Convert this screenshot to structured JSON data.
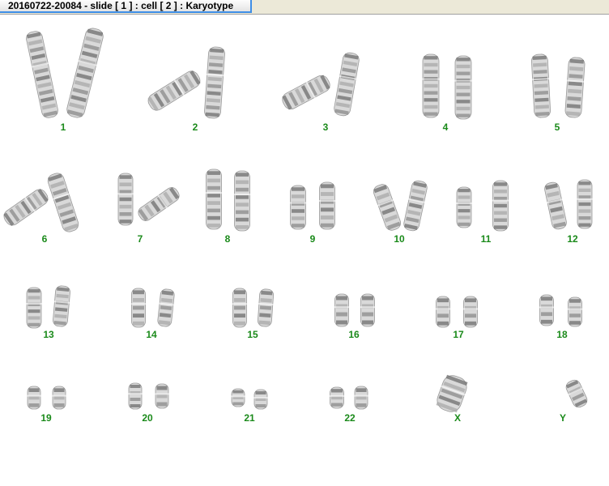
{
  "window": {
    "title": "20160722-20084 - slide [ 1 ] : cell [ 2 ] : Karyotype"
  },
  "karyotype": {
    "label_color": "#1a8a1a",
    "chromosomes": [
      {
        "label": "1"
      },
      {
        "label": "2"
      },
      {
        "label": "3"
      },
      {
        "label": "4"
      },
      {
        "label": "5"
      },
      {
        "label": "6"
      },
      {
        "label": "7"
      },
      {
        "label": "8"
      },
      {
        "label": "9"
      },
      {
        "label": "10"
      },
      {
        "label": "11"
      },
      {
        "label": "12"
      },
      {
        "label": "13"
      },
      {
        "label": "14"
      },
      {
        "label": "15"
      },
      {
        "label": "16"
      },
      {
        "label": "17"
      },
      {
        "label": "18"
      },
      {
        "label": "19"
      },
      {
        "label": "20"
      },
      {
        "label": "21"
      },
      {
        "label": "22"
      },
      {
        "label": "X"
      },
      {
        "label": "Y"
      }
    ]
  }
}
